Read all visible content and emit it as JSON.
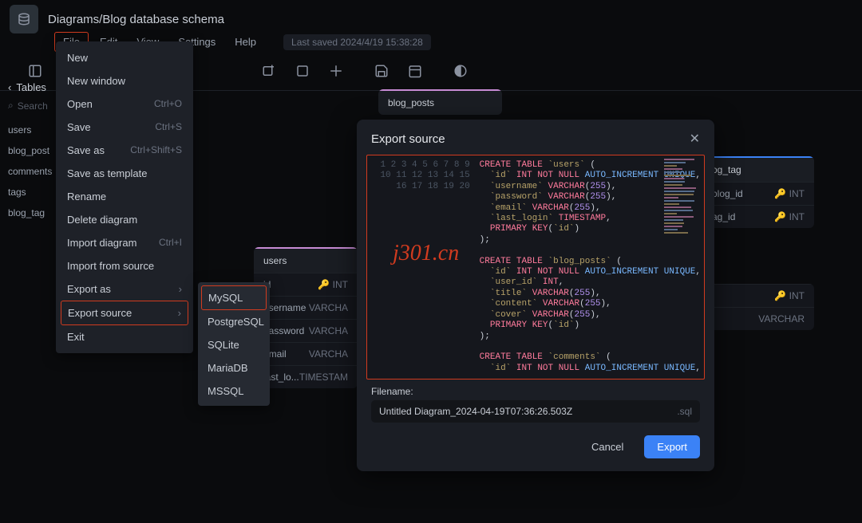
{
  "breadcrumb": "Diagrams/Blog database schema",
  "menubar": {
    "file": "File",
    "edit": "Edit",
    "view": "View",
    "settings": "Settings",
    "help": "Help"
  },
  "last_saved": "Last saved 2024/4/19 15:38:28",
  "sidebar": {
    "header": "Tables",
    "search": "Search",
    "tables": [
      "users",
      "blog_post",
      "comments",
      "tags",
      "blog_tag"
    ]
  },
  "file_menu": [
    {
      "label": "New",
      "key": ""
    },
    {
      "label": "New window",
      "key": ""
    },
    {
      "label": "Open",
      "key": "Ctrl+O"
    },
    {
      "label": "Save",
      "key": "Ctrl+S"
    },
    {
      "label": "Save as",
      "key": "Ctrl+Shift+S"
    },
    {
      "label": "Save as template",
      "key": ""
    },
    {
      "label": "Rename",
      "key": ""
    },
    {
      "label": "Delete diagram",
      "key": ""
    },
    {
      "label": "Import diagram",
      "key": "Ctrl+I"
    },
    {
      "label": "Import from source",
      "key": ""
    },
    {
      "label": "Export as",
      "key": "",
      "arrow": true
    },
    {
      "label": "Export source",
      "key": "",
      "arrow": true
    },
    {
      "label": "Exit",
      "key": ""
    }
  ],
  "sub_menu": [
    "MySQL",
    "PostgreSQL",
    "SQLite",
    "MariaDB",
    "MSSQL"
  ],
  "canvas": {
    "users": {
      "title": "users",
      "rows": [
        [
          "id",
          "INT"
        ],
        [
          "username",
          "VARCHA"
        ],
        [
          "password",
          "VARCHA"
        ],
        [
          "email",
          "VARCHA"
        ],
        [
          "last_lo...",
          "TIMESTAM"
        ]
      ]
    },
    "blog_posts": {
      "title": "blog_posts"
    },
    "blog_tag": {
      "title": "og_tag",
      "rows": [
        [
          "blog_id",
          "INT"
        ],
        [
          "ag_id",
          "INT"
        ]
      ]
    },
    "tags": {
      "rows": [
        [
          "",
          "INT"
        ],
        [
          "",
          "VARCHAR"
        ]
      ]
    }
  },
  "modal": {
    "title": "Export source",
    "filename_label": "Filename:",
    "filename_value": "Untitled Diagram_2024-04-19T07:36:26.503Z",
    "ext": ".sql",
    "cancel": "Cancel",
    "export": "Export"
  },
  "watermark": "j301.cn",
  "chart_data": {
    "type": "table",
    "sql_lines": [
      "CREATE TABLE `users` (",
      "  `id` INT NOT NULL AUTO_INCREMENT UNIQUE,",
      "  `username` VARCHAR(255),",
      "  `password` VARCHAR(255),",
      "  `email` VARCHAR(255),",
      "  `last_login` TIMESTAMP,",
      "  PRIMARY KEY(`id`)",
      ");",
      "",
      "CREATE TABLE `blog_posts` (",
      "  `id` INT NOT NULL AUTO_INCREMENT UNIQUE,",
      "  `user_id` INT,",
      "  `title` VARCHAR(255),",
      "  `content` VARCHAR(255),",
      "  `cover` VARCHAR(255),",
      "  PRIMARY KEY(`id`)",
      ");",
      "",
      "CREATE TABLE `comments` (",
      "  `id` INT NOT NULL AUTO_INCREMENT UNIQUE,"
    ]
  }
}
